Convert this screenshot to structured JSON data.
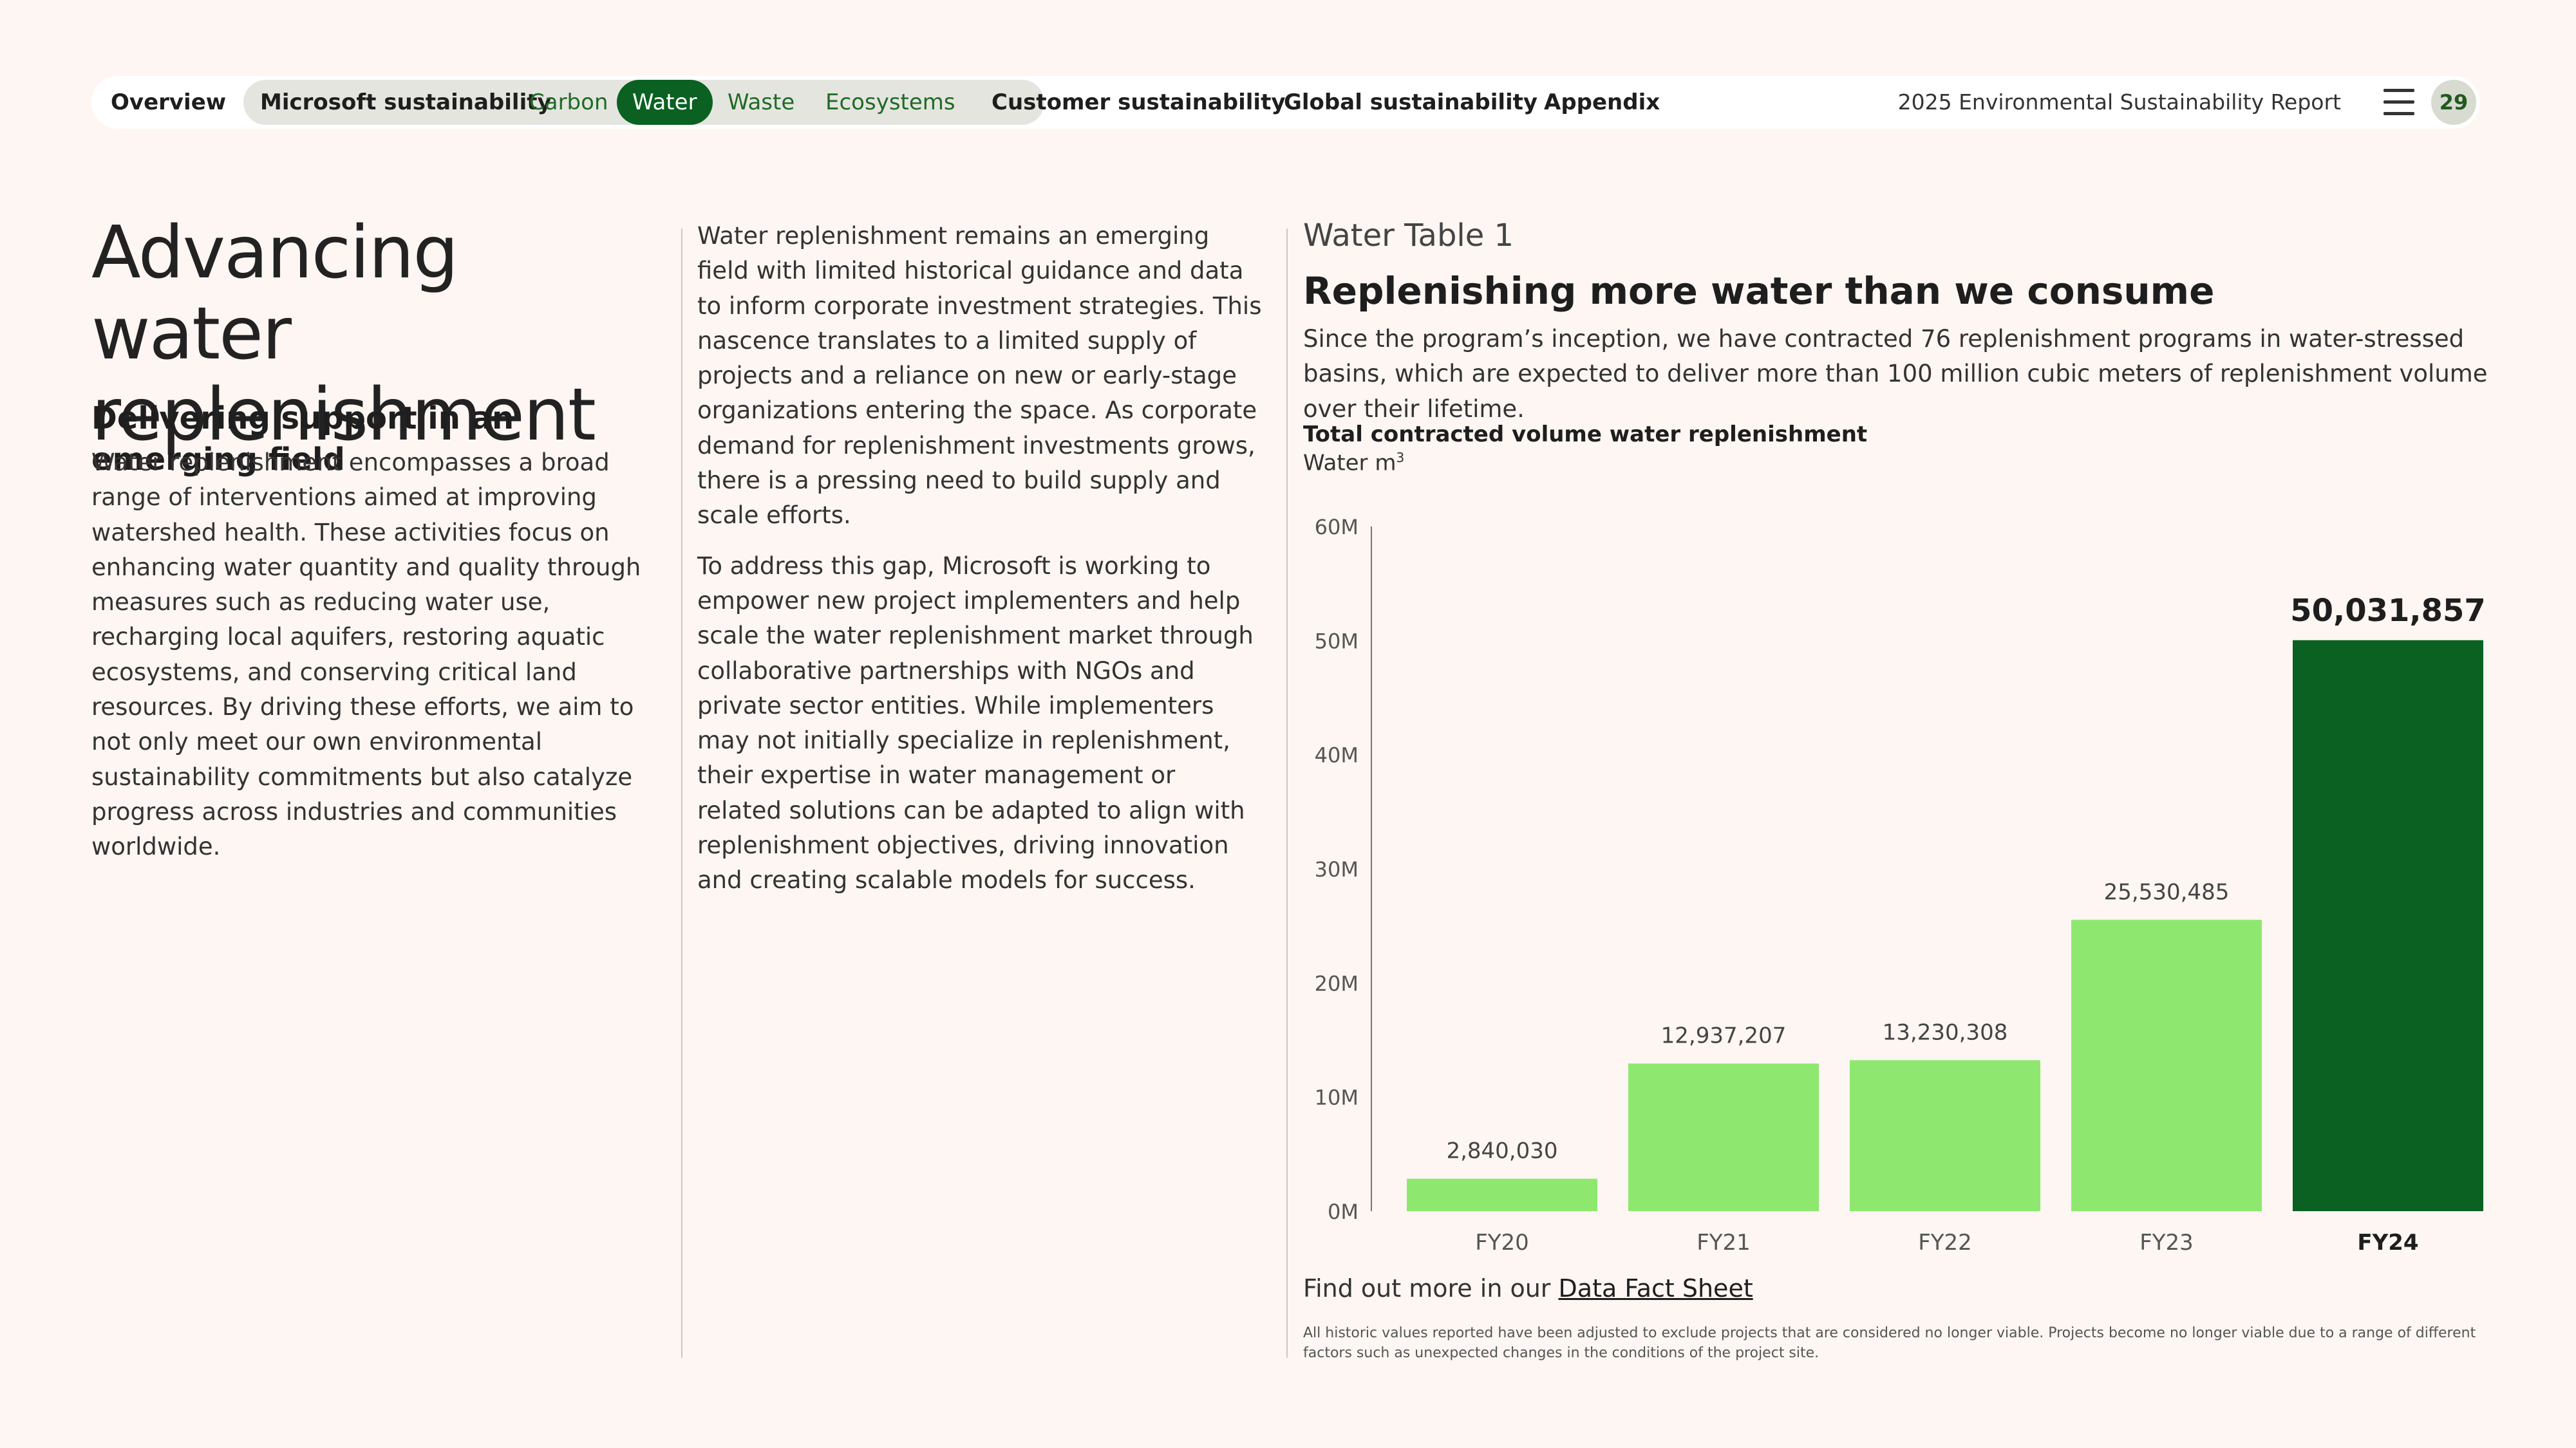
{
  "nav": {
    "overview": "Overview",
    "microsoft_sustainability": "Microsoft sustainability",
    "carbon": "Carbon",
    "water": "Water",
    "waste": "Waste",
    "ecosystems": "Ecosystems",
    "customer_sustainability": "Customer sustainability",
    "global_sustainability": "Global sustainability",
    "appendix": "Appendix",
    "report_title": "2025 Environmental Sustainability Report",
    "page_number": "29",
    "menu_icon": "hamburger-menu-icon"
  },
  "left": {
    "title_line1": "Advancing water",
    "title_line2": "replenishment",
    "subtitle": "Delivering support in an emerging field",
    "body": "Water replenishment encompasses a broad range of interventions aimed at improving watershed health. These activities focus on enhancing water quantity and quality through measures such as reducing water use, recharging local aquifers, restoring aquatic ecosystems, and conserving critical land resources. By driving these efforts, we aim to not only meet our own environmental sustainability commitments but also catalyze progress across industries and communities worldwide."
  },
  "middle": {
    "para1": "Water replenishment remains an emerging field with limited historical guidance and data to inform corporate investment strategies. This nascence translates to a limited supply of projects and a reliance on new or early-stage organizations entering the space. As corporate demand for replenishment investments grows, there is a pressing need to build supply and scale efforts.",
    "para2": "To address this gap, Microsoft is working to empower new project implementers and help scale the water replenishment market through collaborative partnerships with NGOs and private sector entities. While implementers may not initially specialize in replenishment, their expertise in water management or related solutions can be adapted to align with replenishment objectives, driving innovation and creating scalable models for success."
  },
  "right": {
    "table_label": "Water Table 1",
    "heading": "Replenishing more water than we consume",
    "description": "Since the program’s inception, we have contracted 76 replenishment programs in water-stressed basins, which are expected to deliver more than 100 million cubic meters of replenishment volume over their lifetime.",
    "fact_sheet_prefix": "Find out more in our ",
    "fact_sheet_link": "Data Fact Sheet",
    "footnote": "All historic values reported have been adjusted to exclude projects that are considered no longer viable. Projects become no longer viable due to a range of different factors such as unexpected changes in the conditions of the project site."
  },
  "colors": {
    "accent_green": "#0a6121",
    "bar_light_green": "#8ee86f",
    "bar_highlight": "#0a6121",
    "background": "#fdf6f2"
  },
  "chart_data": {
    "type": "bar",
    "title": "Total contracted volume water replenishment",
    "ylabel": "Water m",
    "ylabel_superscript": "3",
    "categories": [
      "FY20",
      "FY21",
      "FY22",
      "FY23",
      "FY24"
    ],
    "values": [
      2840030,
      12937207,
      13230308,
      25530485,
      50031857
    ],
    "value_labels": [
      "2,840,030",
      "12,937,207",
      "13,230,308",
      "25,530,485",
      "50,031,857"
    ],
    "highlight_category": "FY24",
    "ylim": [
      0,
      60000000
    ],
    "yticks": [
      0,
      10000000,
      20000000,
      30000000,
      40000000,
      50000000,
      60000000
    ],
    "ytick_labels": [
      "0M",
      "10M",
      "20M",
      "30M",
      "40M",
      "50M",
      "60M"
    ],
    "grid": false,
    "legend": "none"
  }
}
